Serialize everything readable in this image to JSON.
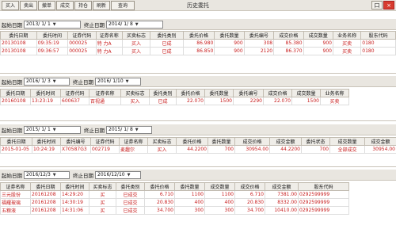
{
  "toolbar": {
    "buttons": [
      "买入",
      "卖出",
      "撤单",
      "成交",
      "持仓",
      "刷新",
      "查询"
    ],
    "title": "历史委托",
    "win": [
      "口",
      "×"
    ]
  },
  "section1": {
    "start_label": "起始日期",
    "start": "2013/ 1/ 1",
    "end_label": "终止日期",
    "end": "2014/ 1/ 8",
    "headers": [
      "委托日期",
      "委托时间",
      "证券代码",
      "证券名称",
      "买卖标志",
      "委托类别",
      "委托价格",
      "委托数量",
      "委托编号",
      "成交价格",
      "成交数量",
      "业务名称",
      "股东代码"
    ],
    "rows": [
      [
        "20130108",
        "09:35:19",
        "000025",
        "特 力A",
        "买入",
        "已成",
        "86.980",
        "900",
        "308",
        "85.380",
        "900",
        "买卖",
        "0180"
      ],
      [
        "20130108",
        "09:36:57",
        "000025",
        "特 力A",
        "买入",
        "已成",
        "86.850",
        "900",
        "2120",
        "86.370",
        "900",
        "买卖",
        "0180"
      ]
    ]
  },
  "section2": {
    "start_label": "起始日期",
    "start": "2016/ 1/ 3",
    "end_label": "终止日期",
    "end": "2016/ 1/10",
    "headers": [
      "委托日期",
      "委托时间",
      "证券代码",
      "证券名称",
      "买卖标志",
      "委托类别",
      "委托价格",
      "委托数量",
      "委托编号",
      "成交价格",
      "成交数量",
      "业务名称"
    ],
    "rows": [
      [
        "20160108",
        "13:23:19",
        "600637",
        "百视通",
        "买入",
        "已成",
        "22.070",
        "1500",
        "2290",
        "22.070",
        "1500",
        "买卖"
      ]
    ]
  },
  "section3": {
    "start_label": "起始日期",
    "start": "2015/ 1/ 1",
    "end_label": "终止日期",
    "end": "2015/ 1/ 8",
    "headers": [
      "委托日期",
      "委托时间",
      "委托编号",
      "证券代码",
      "证券名称",
      "买卖标志",
      "委托价格",
      "委托数量",
      "成交价格",
      "成交金额",
      "委托状态",
      "成交数量",
      "成交金额"
    ],
    "rows": [
      [
        "2015-01-05",
        "10:24:19",
        "X70587G3",
        "002719",
        "麦趣尔",
        "买入",
        "44.2200",
        "700",
        "30954.00",
        "44.2200",
        "700",
        "全部成交",
        "30954.00"
      ]
    ]
  },
  "section4": {
    "start_label": "起始日期",
    "start": "2016/12/3",
    "end_label": "终止日期",
    "end": "2016/12/10",
    "headers": [
      "证券名称",
      "委托日期",
      "委托时间",
      "买卖标志",
      "委托类别",
      "委托价格",
      "委托数量",
      "成交数量",
      "成交价格",
      "成交金额",
      "股东代码"
    ],
    "rows": [
      [
        "三元股份",
        "20161208",
        "14:29:20",
        "买",
        "已成交",
        "6.710",
        "1100",
        "1100",
        "6.710",
        "7381.00",
        "0292599999"
      ],
      [
        "福耀玻璃",
        "20161208",
        "14:30:19",
        "买",
        "已成交",
        "20.830",
        "400",
        "400",
        "20.830",
        "8332.00",
        "0292599999"
      ],
      [
        "五粮液",
        "20161208",
        "14:31:06",
        "买",
        "已成交",
        "34.700",
        "300",
        "300",
        "34.700",
        "10410.00",
        "0292599999"
      ]
    ]
  }
}
